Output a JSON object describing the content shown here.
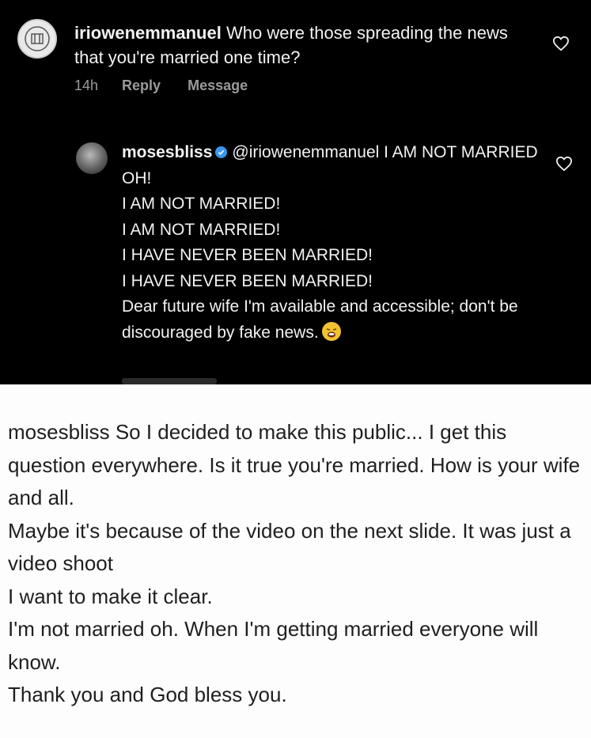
{
  "comment": {
    "username": "iriowenemmanuel",
    "text": "Who were those spreading the news that you're married one time?",
    "time": "14h",
    "reply_label": "Reply",
    "message_label": "Message"
  },
  "reply": {
    "username": "mosesbliss",
    "mention": "@iriowenemmanuel",
    "lines": [
      "I AM NOT MARRIED OH!",
      "I AM NOT MARRIED!",
      "I AM NOT MARRIED!",
      "I HAVE NEVER BEEN MARRIED!",
      "I HAVE NEVER BEEN MARRIED!",
      "Dear future wife I'm available and accessible; don't be discouraged by fake news."
    ],
    "emoji": "weary-face-emoji"
  },
  "caption": {
    "username": "mosesbliss",
    "lines": [
      "So I decided to make this public... I get this question everywhere. Is it true you're married. How is your wife and all.",
      "Maybe it's because of the video on the next slide. It was just a video shoot",
      "I want to make it clear.",
      "I'm not married oh. When I'm getting married everyone will know.",
      "Thank you and God bless you."
    ]
  },
  "icons": {
    "like": "heart-outline-icon",
    "verified": "verified-badge-icon"
  },
  "colors": {
    "dark_bg": "#000000",
    "light_bg": "#fdfdfd",
    "verified_blue": "#3897f0",
    "meta_gray": "#9a9a9a"
  }
}
